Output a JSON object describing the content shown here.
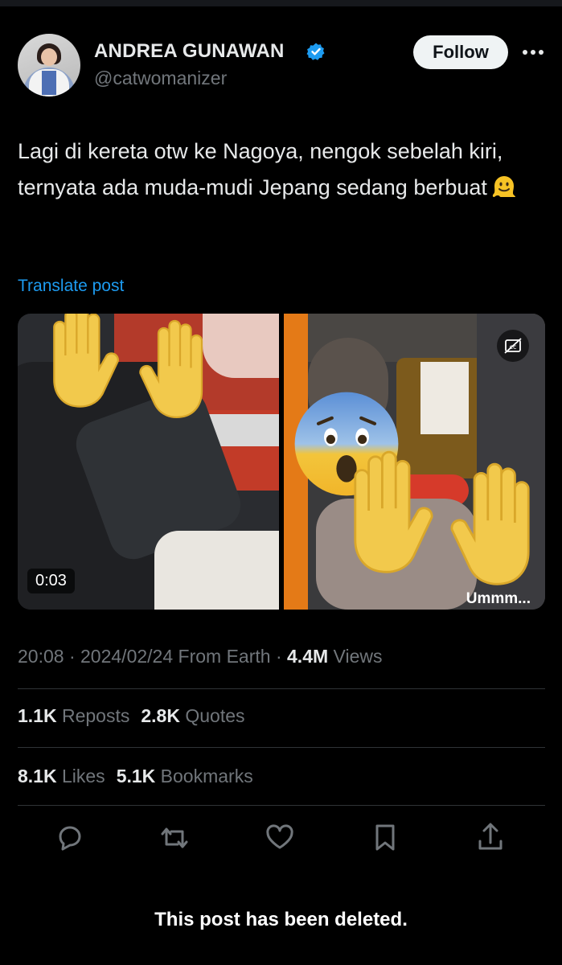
{
  "author": {
    "name": "ANDREA GUNAWAN",
    "handle": "@catwomanizer",
    "follow_label": "Follow"
  },
  "tweet": {
    "text": "Lagi di kereta otw ke Nagoya, nengok sebelah kiri, ternyata ada muda-mudi Jepang sedang berbuat",
    "emoji": "melting-face-emoji",
    "translate_label": "Translate post"
  },
  "media": {
    "video_time": "0:03",
    "caption": "Ummm..."
  },
  "meta": {
    "time": "20:08",
    "date": "2024/02/24",
    "source": "From Earth",
    "views_count": "4.4M",
    "views_label": "Views"
  },
  "stats": {
    "reposts_count": "1.1K",
    "reposts_label": "Reposts",
    "quotes_count": "2.8K",
    "quotes_label": "Quotes",
    "likes_count": "8.1K",
    "likes_label": "Likes",
    "bookmarks_count": "5.1K",
    "bookmarks_label": "Bookmarks"
  },
  "actions": [
    "reply-icon",
    "repost-icon",
    "like-icon",
    "bookmark-icon",
    "share-icon"
  ],
  "status": {
    "deleted_message": "This post has been deleted."
  },
  "colors": {
    "background": "#000000",
    "accent": "#1d9bf0",
    "muted": "#71767b",
    "text": "#e7e9ea"
  }
}
